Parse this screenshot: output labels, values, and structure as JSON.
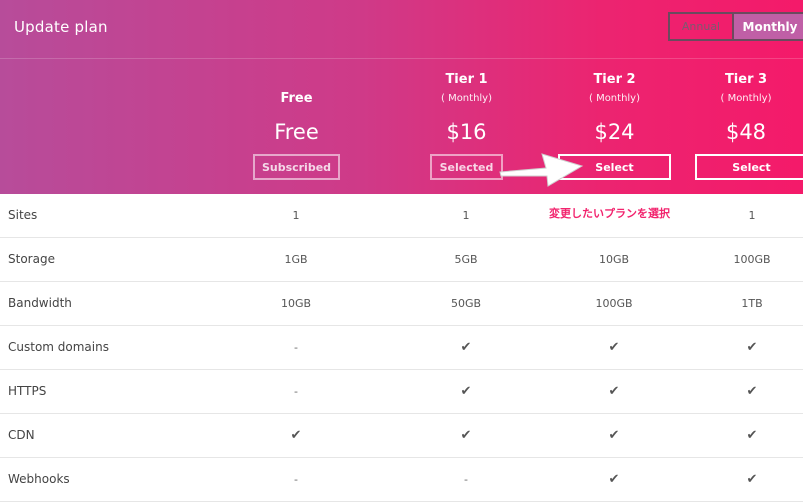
{
  "header": {
    "title": "Update plan"
  },
  "billing_toggle": {
    "annual_label": "Annual",
    "monthly_label": "Monthly",
    "selected": "Monthly"
  },
  "plans": [
    {
      "name": "Free",
      "period": "",
      "price": "Free",
      "button": "Subscribed"
    },
    {
      "name": "Tier 1",
      "period": "( Monthly)",
      "price": "$16",
      "button": "Selected"
    },
    {
      "name": "Tier 2",
      "period": "( Monthly)",
      "price": "$24",
      "button": "Select"
    },
    {
      "name": "Tier 3",
      "period": "( Monthly)",
      "price": "$48",
      "button": "Select"
    }
  ],
  "features": [
    {
      "label": "Sites",
      "values": [
        "1",
        "1",
        "",
        "1"
      ]
    },
    {
      "label": "Storage",
      "values": [
        "1GB",
        "5GB",
        "10GB",
        "100GB"
      ]
    },
    {
      "label": "Bandwidth",
      "values": [
        "10GB",
        "50GB",
        "100GB",
        "1TB"
      ]
    },
    {
      "label": "Custom domains",
      "values": [
        "-",
        "✔",
        "✔",
        "✔"
      ]
    },
    {
      "label": "HTTPS",
      "values": [
        "-",
        "✔",
        "✔",
        "✔"
      ]
    },
    {
      "label": "CDN",
      "values": [
        "✔",
        "✔",
        "✔",
        "✔"
      ]
    },
    {
      "label": "Webhooks",
      "values": [
        "-",
        "-",
        "✔",
        "✔"
      ]
    }
  ],
  "annotation": {
    "text": "変更したいプランを選択",
    "color": "#f2246e"
  },
  "colors": {
    "gradient_start": "#b74c9a",
    "gradient_end": "#f41a6a",
    "toggle_active": "#c05fa6"
  }
}
